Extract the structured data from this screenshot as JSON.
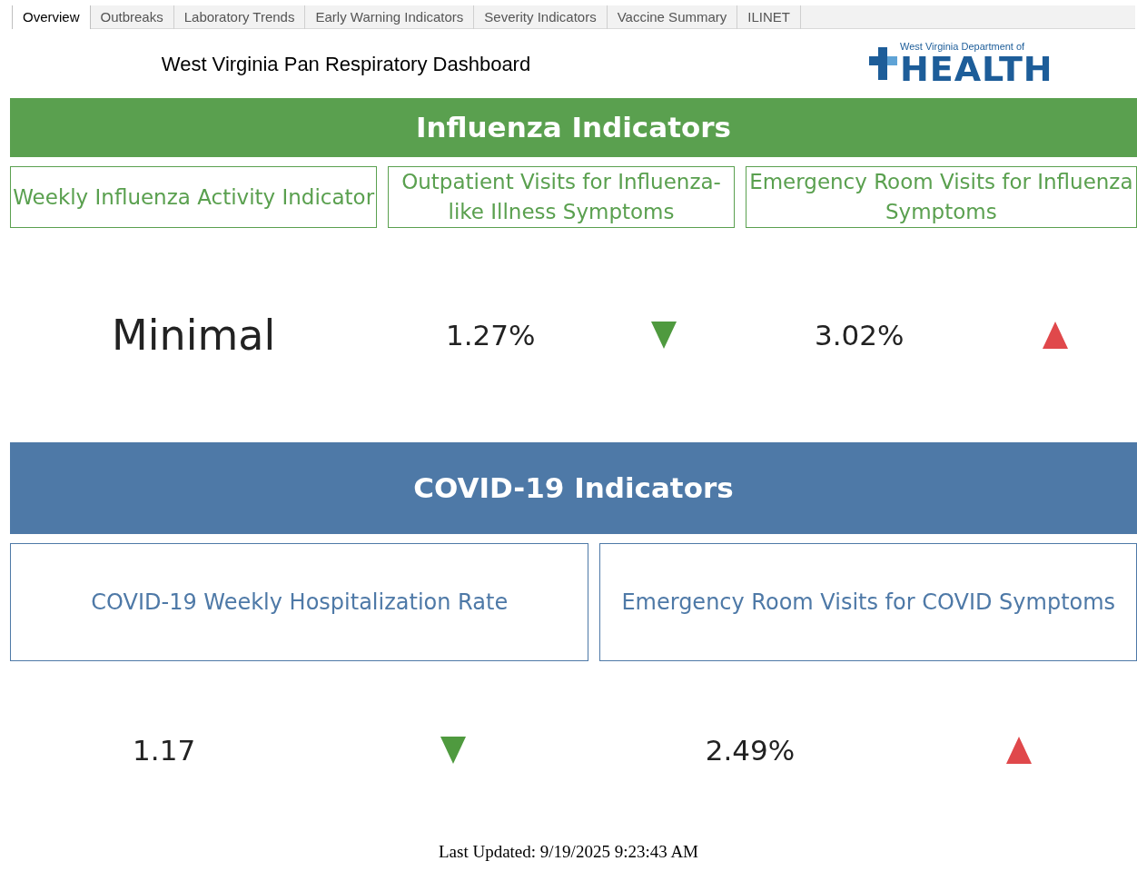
{
  "tabs": [
    {
      "label": "Overview",
      "selected": true
    },
    {
      "label": "Outbreaks",
      "selected": false
    },
    {
      "label": "Laboratory Trends",
      "selected": false
    },
    {
      "label": "Early Warning Indicators",
      "selected": false
    },
    {
      "label": "Severity Indicators",
      "selected": false
    },
    {
      "label": "Vaccine Summary",
      "selected": false
    },
    {
      "label": "ILINET",
      "selected": false
    }
  ],
  "header": {
    "title": "West Virginia Pan Respiratory Dashboard",
    "logo": {
      "line_1": "West Virginia Department of",
      "line_2": "HEALTH"
    }
  },
  "sections": [
    {
      "kind": "influenza",
      "title": "Influenza Indicators",
      "cards": [
        {
          "label": "Weekly Influenza Activity Indicator",
          "value": "Minimal"
        },
        {
          "label": "Outpatient Visits for Influenza-like Illness Symptoms",
          "value": "1.27%",
          "trending_up": false
        },
        {
          "label": "Emergency Room Visits for Influenza Symptoms",
          "value": "3.02%",
          "trending_up": true
        }
      ]
    },
    {
      "kind": "covid",
      "title": "COVID-19 Indicators",
      "cards": [
        {
          "label": "COVID-19 Weekly Hospitalization Rate",
          "value": "1.17",
          "trending_up": false
        },
        {
          "label": "Emergency Room Visits for COVID Symptoms",
          "value": "2.49%",
          "trending_up": true
        }
      ]
    }
  ],
  "last_updated": "Last Updated: 9/19/2025 9:23:43 AM"
}
